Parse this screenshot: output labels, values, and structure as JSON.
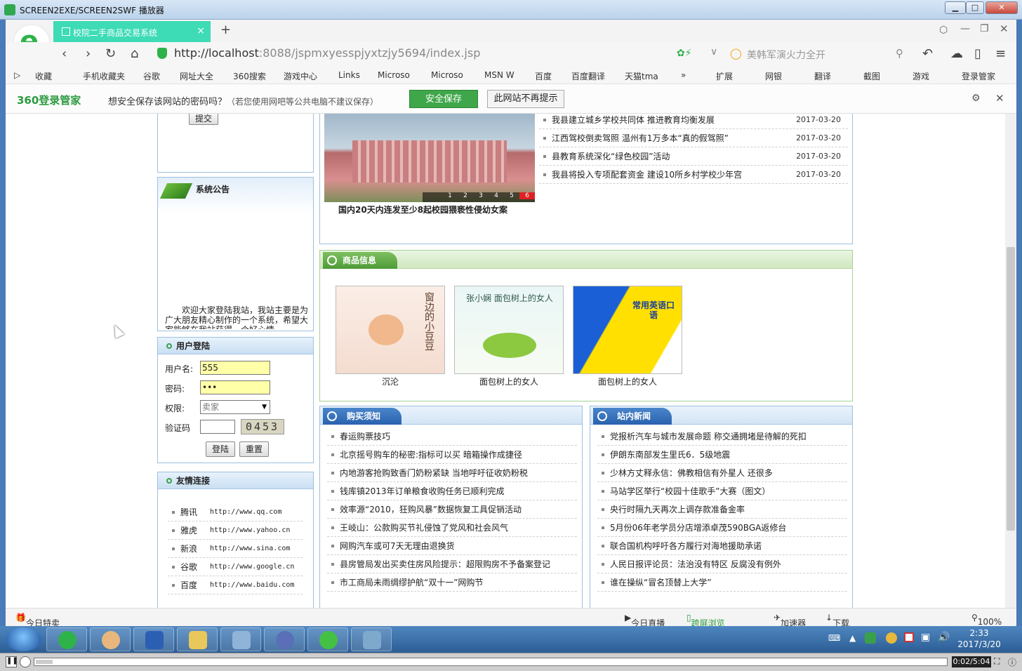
{
  "window": {
    "title": "SCREEN2EXE/SCREEN2SWF 播放器"
  },
  "browser": {
    "logo_glyph": "e",
    "tab": {
      "label": "校院二手商品交易系统",
      "close": "×"
    },
    "new_tab": "+",
    "url": {
      "host": "http://localhost",
      "rest": ":8088/jspmxyesspjyxtzjy5694/index.jsp"
    },
    "search": {
      "placeholder": "美韩军演火力全开"
    },
    "bookmarks": [
      "收藏",
      "手机收藏夹",
      "谷歌",
      "网址大全",
      "360搜索",
      "游戏中心",
      "Links",
      "Microso",
      "Microso",
      "MSN W",
      "百度",
      "百度翻译",
      "天猫tma",
      "»"
    ],
    "toolbar_right": [
      "扩展",
      "网银",
      "翻译",
      "截图",
      "游戏",
      "登录管家"
    ],
    "pw_bar": {
      "brand": "360登录管家",
      "message": "想安全保存该网站的密码吗？",
      "sub": "（若您使用网吧等公共电脑不建议保存）",
      "save": "安全保存",
      "never": "此网站不再提示"
    },
    "status": {
      "left": "今日特卖",
      "live": "今日直播",
      "cross": "跨屏浏览",
      "speed": "加速器",
      "download": "下载",
      "zoom": "100%"
    }
  },
  "page": {
    "submit_btn": "提交",
    "notice": {
      "title": "系统公告",
      "text": "欢迎大家登陆我站，我站主要是为广大朋友精心制作的一个系统，希望大家能够在我站获得一个好心情"
    },
    "login": {
      "title": "用户登陆",
      "username_label": "用户名:",
      "username_value": "555",
      "password_label": "密码:",
      "password_value": "•••",
      "role_label": "权限:",
      "role_value": "卖家",
      "captcha_label": "验证码",
      "captcha_value": "0453",
      "login_btn": "登陆",
      "reset_btn": "重置"
    },
    "links": {
      "title": "友情连接",
      "items": [
        {
          "name": "腾讯",
          "url": "http://www.qq.com"
        },
        {
          "name": "雅虎",
          "url": "http://www.yahoo.cn"
        },
        {
          "name": "新浪",
          "url": "http://www.sina.com"
        },
        {
          "name": "谷歌",
          "url": "http://www.google.cn"
        },
        {
          "name": "百度",
          "url": "http://www.baidu.com"
        }
      ]
    },
    "slideshow": {
      "caption": "国内20天内连发至少8起校园猥亵性侵幼女案",
      "pages": [
        "1",
        "2",
        "3",
        "4",
        "5",
        "6"
      ]
    },
    "top_news": [
      {
        "title": "我县建立城乡学校共同体 推进教育均衡发展",
        "date": "2017-03-20"
      },
      {
        "title": "江西驾校倒卖驾照 温州有1万多本“真的假驾照”",
        "date": "2017-03-20"
      },
      {
        "title": "县教育系统深化“绿色校园”活动",
        "date": "2017-03-20"
      },
      {
        "title": "我县将投入专项配套资金 建设10所乡村学校少年宫",
        "date": "2017-03-20"
      }
    ],
    "products": {
      "title": "商品信息",
      "items": [
        {
          "name": "沉沦",
          "cover": "窗边的小豆豆"
        },
        {
          "name": "面包树上的女人",
          "cover": "张小娴 面包树上的女人"
        },
        {
          "name": "面包树上的女人",
          "cover": "常用英语口语"
        }
      ]
    },
    "purchase": {
      "title": "购买须知",
      "items": [
        "春运购票技巧",
        "北京摇号购车的秘密:指标可以买 暗箱操作成捷径",
        "内地游客抢购致香门奶粉紧缺 当地呼吁征收奶粉税",
        "钱库镇2013年订单粮食收购任务已顺利完成",
        "效率源“2010，狂购风暴”数据恢复工具促销活动",
        "王岐山：公款购买节礼侵蚀了党风和社会风气",
        "网购汽车或可7天无理由退换货",
        "县房管局发出买卖住房风险提示：超限购房不予备案登记",
        "市工商局未雨绸缪护航“双十一”网购节"
      ]
    },
    "site_news": {
      "title": "站内新闻",
      "items": [
        "党报析汽车与城市发展命题 称交通拥堵是待解的死扣",
        "伊朗东南部发生里氏6．5级地震",
        "少林方丈释永信：佛教相信有外星人 还很多",
        "马站学区举行“校园十佳歌手”大赛（图文）",
        "央行时隔九天再次上调存款准备金率",
        "5月份06年老学员分店增添卓茂590BGA返修台",
        "联合国机构呼吁各方履行对海地援助承诺",
        "人民日报评论员：法治没有特区 反腐没有例外",
        "谁在操纵“冒名顶替上大学”"
      ]
    }
  },
  "taskbar": {
    "time": "2:33",
    "date": "2017/3/20"
  },
  "player": {
    "time": "0:02/5:04"
  },
  "colors": {
    "tab": "#3ddbb6",
    "green_head": "#4e9a36",
    "blue_head": "#2a62ad",
    "save_btn": "#3fa74a",
    "taskbar": "#2c5d94"
  }
}
